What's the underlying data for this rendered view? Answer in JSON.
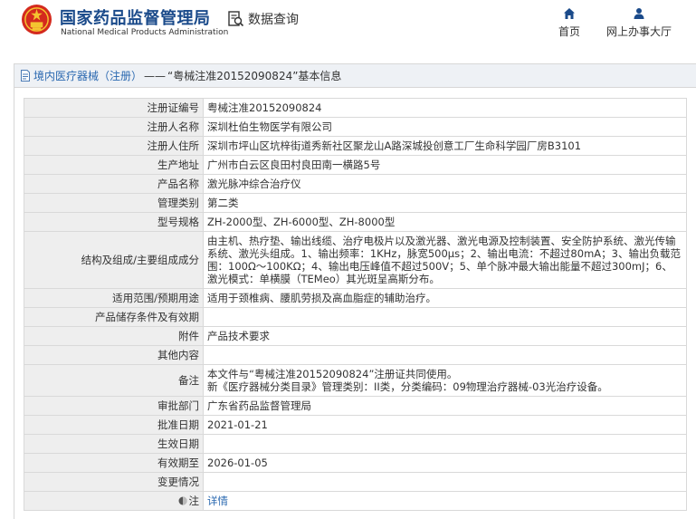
{
  "header": {
    "brand_cn": "国家药品监督管理局",
    "brand_en": "National Medical Products Administration",
    "query_label": "数据查询",
    "nav": [
      {
        "label": "首页",
        "icon": "home-icon"
      },
      {
        "label": "网上办事大厅",
        "icon": "user-icon"
      }
    ]
  },
  "panel": {
    "breadcrumb_link": "境内医疗器械（注册）",
    "breadcrumb_sep": "——",
    "breadcrumb_title": "“粤械注准20152090824”基本信息"
  },
  "rows": [
    {
      "label": "注册证编号",
      "value": "粤械注准20152090824"
    },
    {
      "label": "注册人名称",
      "value": "深圳杜伯生物医学有限公司"
    },
    {
      "label": "注册人住所",
      "value": "深圳市坪山区坑梓街道秀新社区聚龙山A路深城投创意工厂生命科学园厂房B3101"
    },
    {
      "label": "生产地址",
      "value": "广州市白云区良田村良田南一横路5号"
    },
    {
      "label": "产品名称",
      "value": "激光脉冲综合治疗仪"
    },
    {
      "label": "管理类别",
      "value": "第二类"
    },
    {
      "label": "型号规格",
      "value": "ZH-2000型、ZH-6000型、ZH-8000型"
    },
    {
      "label": "结构及组成/主要组成成分",
      "value": "由主机、热疗垫、输出线缆、治疗电极片以及激光器、激光电源及控制装置、安全防护系统、激光传输系统、激光头组成。1、输出频率：1KHz，脉宽500μs；2、输出电流：不超过80mA；3、输出负载范围：100Ω～100KΩ；4、输出电压峰值不超过500V；5、单个脉冲最大输出能量不超过300mJ；6、激光模式：单横膜（TEMeo）其光斑呈高斯分布。"
    },
    {
      "label": "适用范围/预期用途",
      "value": "适用于颈椎病、腰肌劳损及高血脂症的辅助治疗。"
    },
    {
      "label": "产品储存条件及有效期",
      "value": ""
    },
    {
      "label": "附件",
      "value": "产品技术要求"
    },
    {
      "label": "其他内容",
      "value": ""
    },
    {
      "label": "备注",
      "value_line1": "本文件与“粤械注准20152090824”注册证共同使用。",
      "value_line2": "新《医疗器械分类目录》管理类别：II类，分类编码：09物理治疗器械-03光治疗设备。"
    },
    {
      "label": "审批部门",
      "value": "广东省药品监督管理局"
    },
    {
      "label": "批准日期",
      "value": "2021-01-21"
    },
    {
      "label": "生效日期",
      "value": ""
    },
    {
      "label": "有效期至",
      "value": "2026-01-05"
    },
    {
      "label": "变更情况",
      "value": ""
    },
    {
      "label": "注",
      "icon": "note-icon",
      "value": "详情"
    }
  ]
}
